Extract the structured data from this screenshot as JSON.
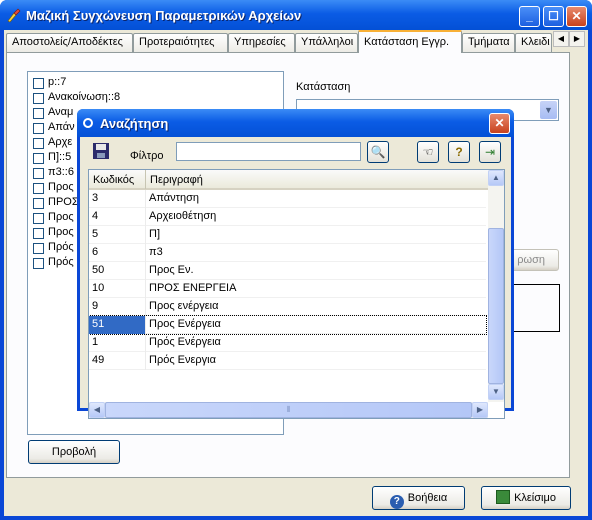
{
  "window": {
    "title": "Μαζική Συγχώνευση Παραμετρικών Αρχείων"
  },
  "tabs": [
    {
      "label": "Αποστολείς/Αποδέκτες"
    },
    {
      "label": "Προτεραιότητες"
    },
    {
      "label": "Υπηρεσίες"
    },
    {
      "label": "Υπάλληλοι"
    },
    {
      "label": "Κατάσταση Εγγρ."
    },
    {
      "label": "Τμήματα"
    },
    {
      "label": "Κλειδι"
    }
  ],
  "checklist": [
    {
      "label": "p::7"
    },
    {
      "label": "Ανακοίνωση::8"
    },
    {
      "label": "Αναμ"
    },
    {
      "label": "Απάν"
    },
    {
      "label": "Αρχε"
    },
    {
      "label": "Π]::5"
    },
    {
      "label": "π3::6"
    },
    {
      "label": "Προς"
    },
    {
      "label": "ΠΡΟΣ"
    },
    {
      "label": "Προς"
    },
    {
      "label": "Προς"
    },
    {
      "label": "Πρός"
    },
    {
      "label": "Πρός"
    }
  ],
  "status_label": "Κατάσταση",
  "partial_button_text": "ρωση",
  "preview_button": "Προβολή",
  "help_button": "Βοήθεια",
  "close_button": "Κλείσιμο",
  "dialog": {
    "title": "Αναζήτηση",
    "filter_label": "Φίλτρο",
    "filter_value": "",
    "columns": [
      "Κωδικός",
      "Περιγραφή"
    ],
    "rows": [
      {
        "code": "3",
        "desc": "Απάντηση"
      },
      {
        "code": "4",
        "desc": "Αρχειοθέτηση"
      },
      {
        "code": "5",
        "desc": "Π]"
      },
      {
        "code": "6",
        "desc": "π3"
      },
      {
        "code": "50",
        "desc": "Προς Εν."
      },
      {
        "code": "10",
        "desc": "ΠΡΟΣ ΕΝΕΡΓΕΙΑ"
      },
      {
        "code": "9",
        "desc": "Προς ενέργεια"
      },
      {
        "code": "51",
        "desc": "Προς Ενέργεια"
      },
      {
        "code": "1",
        "desc": "Πρός Ενέργεια"
      },
      {
        "code": "49",
        "desc": "Πρός Ενεργια"
      }
    ],
    "selected_row": 7
  },
  "colors": {
    "title_bar": "#0b5ce5",
    "selection": "#316ac5",
    "client": "#ece9d8"
  }
}
